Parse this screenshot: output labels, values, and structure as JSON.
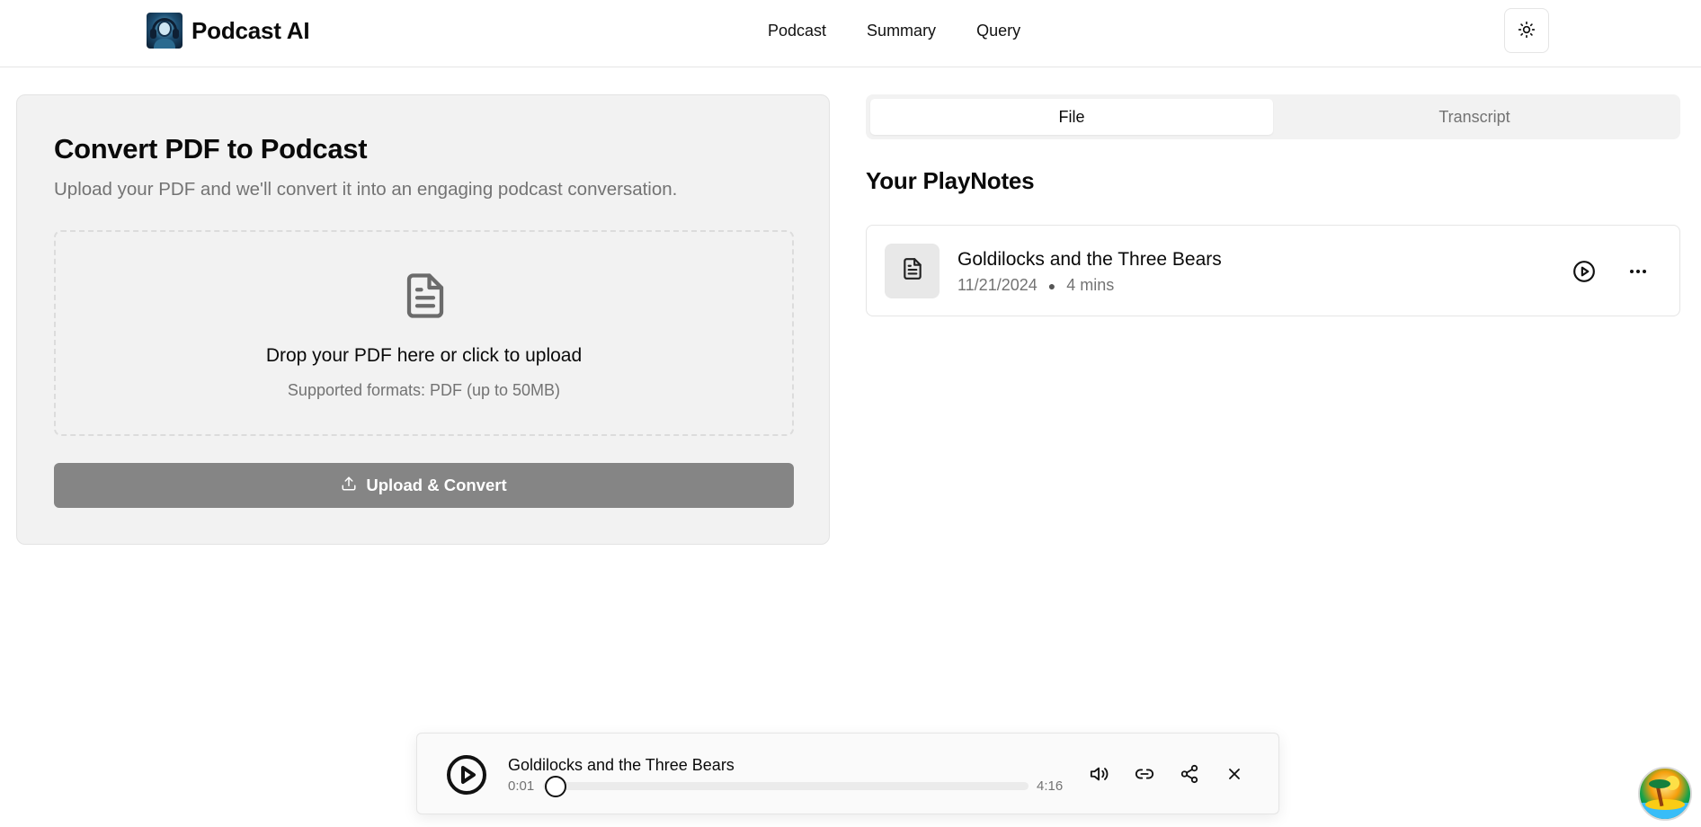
{
  "header": {
    "brand": "Podcast AI",
    "nav": [
      "Podcast",
      "Summary",
      "Query"
    ],
    "theme_toggle_icon": "sun-icon"
  },
  "convert": {
    "title": "Convert PDF to Podcast",
    "subtitle": "Upload your PDF and we'll convert it into an engaging podcast conversation.",
    "dropzone_main": "Drop your PDF here or click to upload",
    "dropzone_sub": "Supported formats: PDF (up to 50MB)",
    "upload_button": "Upload & Convert"
  },
  "tabs": [
    {
      "label": "File",
      "active": true
    },
    {
      "label": "Transcript",
      "active": false
    }
  ],
  "playnotes": {
    "title": "Your PlayNotes",
    "items": [
      {
        "title": "Goldilocks and the Three Bears",
        "date": "11/21/2024",
        "duration": "4 mins"
      }
    ]
  },
  "player": {
    "title": "Goldilocks and the Three Bears",
    "current_time": "0:01",
    "duration": "4:16",
    "progress_fraction": 0.004
  },
  "colors": {
    "accent_button": "#858585",
    "card_bg": "#f2f2f2",
    "muted_text": "#737373"
  }
}
